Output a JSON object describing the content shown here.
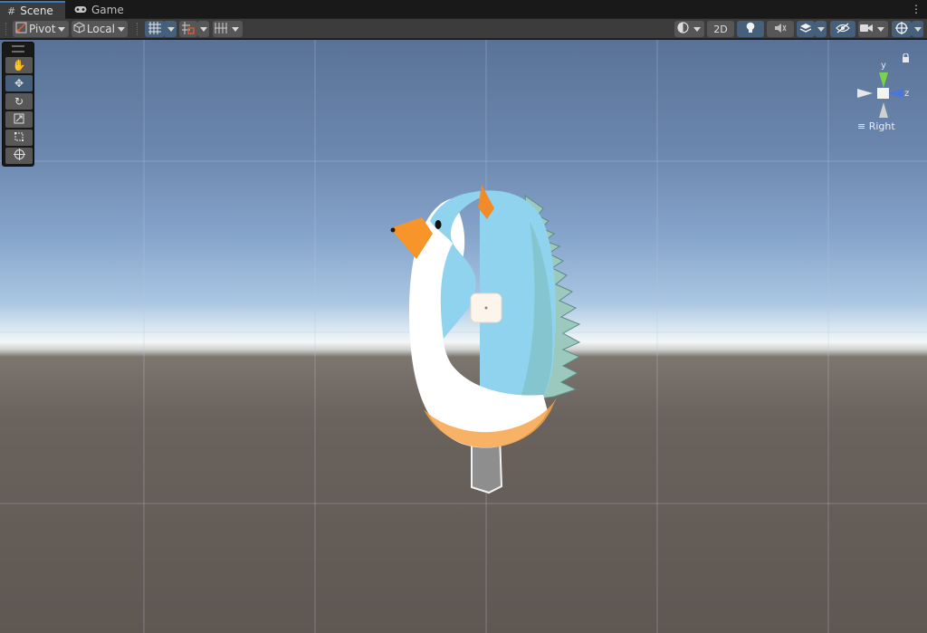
{
  "tabs": [
    {
      "label": "Scene",
      "icon": "grid-icon"
    },
    {
      "label": "Game",
      "icon": "gamepad-icon"
    }
  ],
  "toolbar": {
    "pivot_label": "Pivot",
    "local_label": "Local",
    "mode_2d_label": "2D"
  },
  "gizmo": {
    "y_label": "y",
    "z_label": "z",
    "view_label": "Right",
    "colors": {
      "y": "#7ad14a",
      "z": "#4a76e0",
      "neutral": "#e7e7e7"
    }
  },
  "tools": [
    "hand-icon",
    "move-icon",
    "rotate-icon",
    "scale-icon",
    "rect-icon",
    "transform-icon"
  ],
  "colors": {
    "accent": "#46607c",
    "body_blue": "#8fd3ef",
    "belly_white": "#ffffff",
    "beak_orange": "#f7952b",
    "horn_orange": "#f08a2a",
    "stick_gray": "#8e8e8e"
  }
}
